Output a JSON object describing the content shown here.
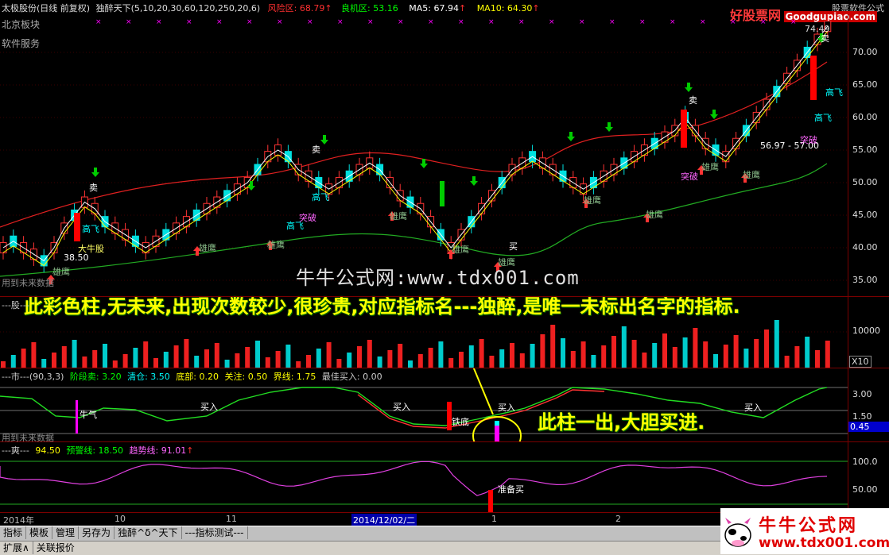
{
  "header": {
    "title": "太极股份(日线 前复权)",
    "indicator": "独醉天下(5,10,20,30,60,120,250,20,6)",
    "risk_label": "风险区: 68.79",
    "good_label": "良机区: 53.16",
    "ma5": "MA5: 67.94",
    "ma10": "MA10: 64.30",
    "right_top": "股票软件公式"
  },
  "sector": {
    "line1": "北京板块",
    "line2": "软件服务"
  },
  "brand": {
    "logo_text": "好股票网",
    "logo_url": "Goodgupiao.com"
  },
  "price_axis": [
    "70.00",
    "65.00",
    "60.00",
    "55.00",
    "50.00",
    "45.00",
    "40.00",
    "35.00"
  ],
  "price_labels": {
    "top_price": "74.49",
    "low_price": "38.50",
    "range_label": "56.97 - 57.00",
    "future_note": "用到未来数据"
  },
  "chart_annotations": {
    "sell": "卖",
    "breakout": "突破",
    "high_fly": "高飞",
    "eagle": "雄鹰",
    "big_bull": "大牛股",
    "buy": "买"
  },
  "watermark": {
    "text": "牛牛公式网:www.tdx001.com"
  },
  "overlay_texts": {
    "yellow_note": "此彩色柱,无未来,出现次数较少,很珍贵,对应指标名---独醉,是唯一未标出名字的指标.",
    "green_note": "此柱一出,大胆买进."
  },
  "volume_panel": {
    "label": "---股---",
    "axis_top": "10000",
    "axis_unit": "X10"
  },
  "market_panel": {
    "title": "---市---(90,3,3)",
    "stage_sell": "阶段卖: 3.20",
    "clear": "清仓: 3.50",
    "bottom": "底部: 0.20",
    "watch": "关注: 0.50",
    "boundary": "界线: 1.75",
    "best_buy": "最佳买入: 0.00",
    "axis": [
      "3.00",
      "1.50"
    ],
    "current_value": "0.45",
    "labels": {
      "bull": "牛气",
      "buy": "买入",
      "iron_bottom": "铁底"
    },
    "future_note": "用到未来数据"
  },
  "cool_panel": {
    "title": "---爽---",
    "value": "94.50",
    "warning": "预警线: 18.50",
    "trend": "趋势线: 91.01",
    "axis": [
      "100.0",
      "50.00"
    ],
    "ready_buy": "准备买"
  },
  "time_axis": {
    "year": "2014年",
    "m10": "10",
    "m11": "11",
    "date_box": "2014/12/02/二",
    "m1": "1",
    "m2": "2"
  },
  "tabs": [
    "指标",
    "模板",
    "管理",
    "另存为",
    "独醉^δ^天下",
    "---指标测试---"
  ],
  "status": [
    "扩展∧",
    "关联报价"
  ],
  "footer_brand": {
    "name": "牛牛公式网",
    "url": "www.tdx001.com"
  },
  "colors": {
    "up": "#ff3333",
    "down": "#00ffff",
    "ma_white": "#ffffff",
    "ma_yellow": "#ffff00",
    "risk": "#ff3030",
    "good": "#00ff00",
    "accent_magenta": "#ff00ff"
  }
}
